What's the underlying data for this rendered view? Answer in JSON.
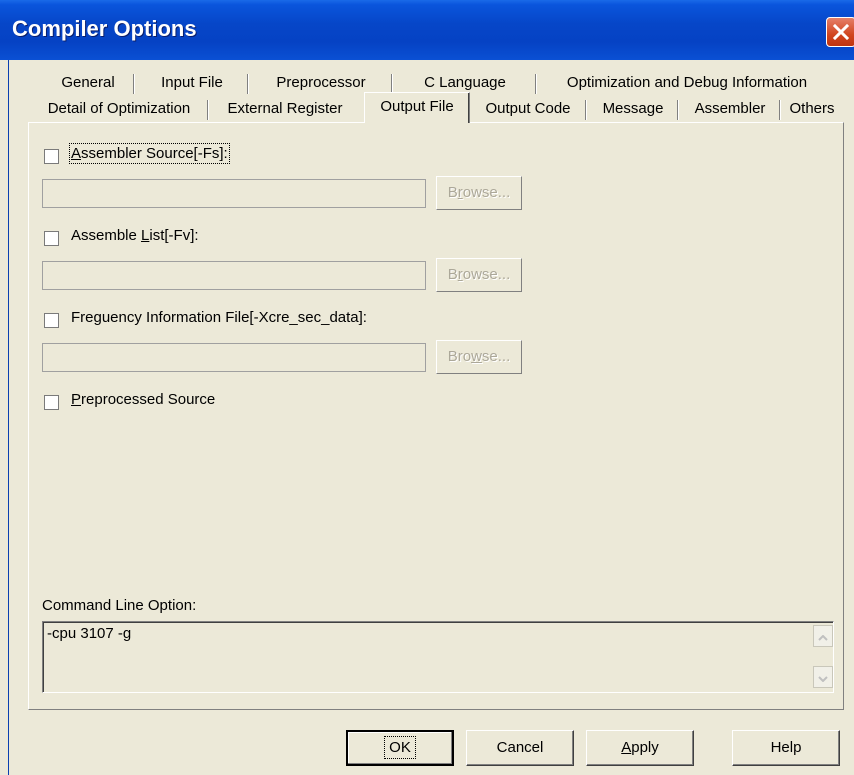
{
  "window": {
    "title": "Compiler Options"
  },
  "tabs_row1": [
    "General",
    "Input File",
    "Preprocessor",
    "C Language",
    "Optimization and Debug Information"
  ],
  "tabs_row2": [
    "Detail of Optimization",
    "External Register",
    "Output File",
    "Output Code",
    "Message",
    "Assembler",
    "Others"
  ],
  "active_tab": "Output File",
  "options": [
    {
      "label_pre": "",
      "mnemonic": "A",
      "label_post": "ssembler Source[-Fs]:",
      "checked": false,
      "has_path": true,
      "path_value": "",
      "browse_label_pre": "B",
      "browse_mnemonic": "r",
      "browse_label_post": "owse...",
      "browse_enabled": false
    },
    {
      "label_pre": "Assemble ",
      "mnemonic": "L",
      "label_post": "ist[-Fv]:",
      "checked": false,
      "has_path": true,
      "path_value": "",
      "browse_label_pre": "B",
      "browse_mnemonic": "r",
      "browse_label_post": "owse...",
      "browse_enabled": false
    },
    {
      "label_pre": "Freguency Information File[-Xcre_sec_data]:",
      "mnemonic": "",
      "label_post": "",
      "checked": false,
      "has_path": true,
      "path_value": "",
      "browse_label_pre": "Bro",
      "browse_mnemonic": "w",
      "browse_label_post": "se...",
      "browse_enabled": false
    },
    {
      "label_pre": "",
      "mnemonic": "P",
      "label_post": "reprocessed Source",
      "checked": false,
      "has_path": false
    }
  ],
  "command_line": {
    "label": "Command Line Option:",
    "value": "-cpu 3107 -g"
  },
  "buttons": {
    "ok": "OK",
    "cancel": "Cancel",
    "apply_pre": "",
    "apply_mnemonic": "A",
    "apply_post": "pply",
    "help": "Help"
  }
}
